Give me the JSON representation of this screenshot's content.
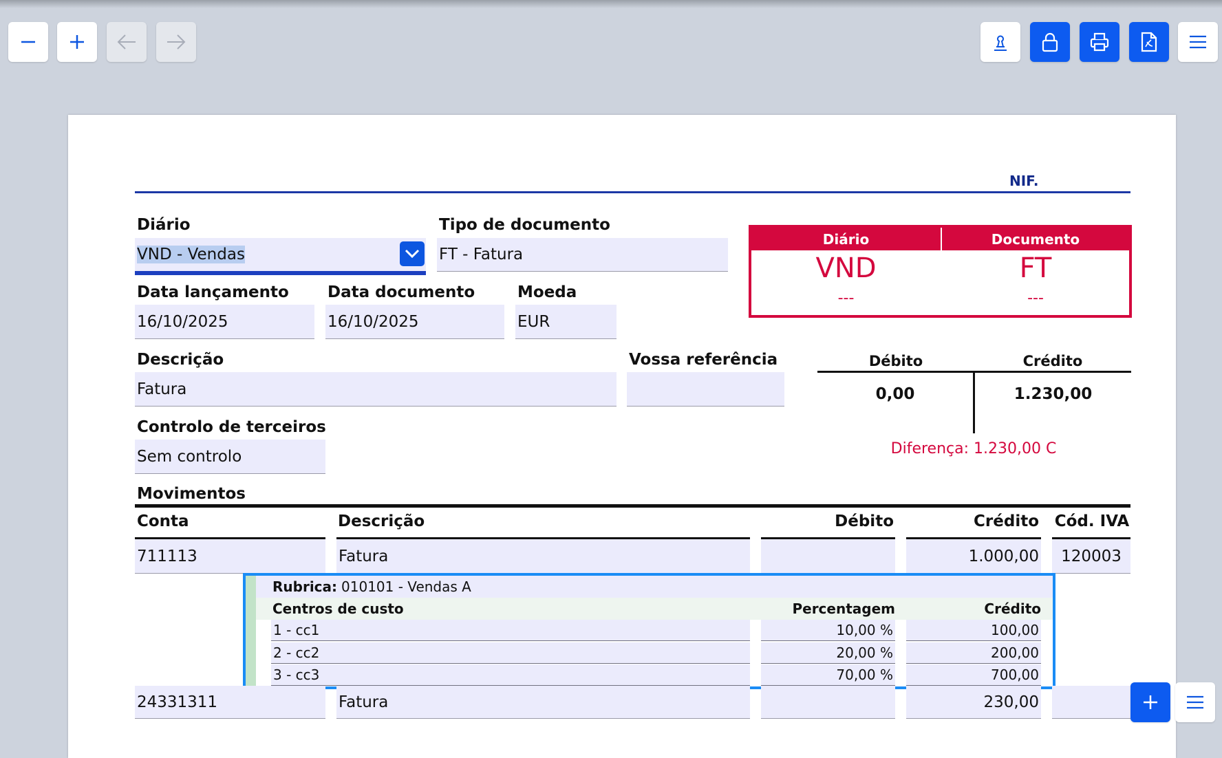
{
  "toolbar": {
    "zoom_out": "minus-icon",
    "zoom_in": "plus-icon",
    "back": "arrow-left-icon",
    "forward": "arrow-right-icon",
    "stamp": "stamp-icon",
    "lock": "lock-icon",
    "print": "printer-icon",
    "pdf": "pdf-icon",
    "menu": "menu-icon"
  },
  "header": {
    "nif_label": "NIF."
  },
  "form": {
    "diario_label": "Diário",
    "diario_value": "VND - Vendas",
    "tipo_label": "Tipo de documento",
    "tipo_value": "FT - Fatura",
    "data_lanc_label": "Data lançamento",
    "data_lanc_value": "16/10/2025",
    "data_doc_label": "Data documento",
    "data_doc_value": "16/10/2025",
    "moeda_label": "Moeda",
    "moeda_value": "EUR",
    "descricao_label": "Descrição",
    "descricao_value": "Fatura",
    "vossa_ref_label": "Vossa referência",
    "vossa_ref_value": "",
    "controlo_label": "Controlo de terceiros",
    "controlo_value": "Sem controlo"
  },
  "summary_box": {
    "diario_header": "Diário",
    "documento_header": "Documento",
    "diario_code": "VND",
    "documento_code": "FT",
    "diario_number": "---",
    "documento_number": "---"
  },
  "totals": {
    "debito_label": "Débito",
    "credito_label": "Crédito",
    "debito_value": "0,00",
    "credito_value": "1.230,00",
    "diferenca": "Diferença: 1.230,00 C"
  },
  "movimentos": {
    "title": "Movimentos",
    "columns": [
      "Conta",
      "Descrição",
      "Débito",
      "Crédito",
      "Cód. IVA"
    ],
    "rows": [
      {
        "conta": "711113",
        "descricao": "Fatura",
        "debito": "",
        "credito": "1.000,00",
        "cod_iva": "120003"
      },
      {
        "conta": "24331311",
        "descricao": "Fatura",
        "debito": "",
        "credito": "230,00",
        "cod_iva": ""
      }
    ]
  },
  "cost_centers": {
    "rubrica_label": "Rubrica:",
    "rubrica_value": "010101 - Vendas A",
    "col_centros": "Centros de custo",
    "col_percentagem": "Percentagem",
    "col_credito": "Crédito",
    "rows": [
      {
        "centro": "1 - cc1",
        "percentagem": "10,00 %",
        "credito": "100,00"
      },
      {
        "centro": "2 - cc2",
        "percentagem": "20,00 %",
        "credito": "200,00"
      },
      {
        "centro": "3 - cc3",
        "percentagem": "70,00 %",
        "credito": "700,00"
      }
    ]
  },
  "row_actions": {
    "add": "plus-icon",
    "menu": "menu-icon"
  },
  "colors": {
    "accent": "#0d5bf0",
    "alert": "#d4083e",
    "field_bg": "#ebebfc",
    "cc_border": "#1a8cf5"
  }
}
